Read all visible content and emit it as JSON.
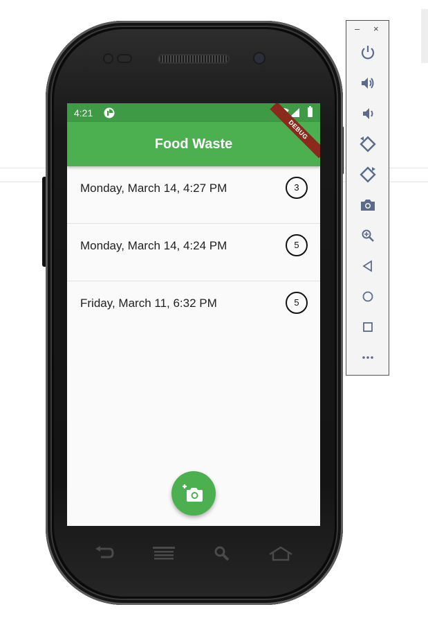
{
  "app": {
    "title": "Food Waste",
    "debug_banner": "DEBUG",
    "status_bar": {
      "time": "4:21"
    }
  },
  "entries": [
    {
      "label": "Monday, March 14, 4:27 PM",
      "count": "3"
    },
    {
      "label": "Monday, March 14, 4:24 PM",
      "count": "5"
    },
    {
      "label": "Friday, March 11, 6:32 PM",
      "count": "5"
    }
  ],
  "fab": {
    "icon": "add-a-photo-icon"
  },
  "device_nav": [
    "back-icon",
    "menu-icon",
    "search-icon",
    "home-icon"
  ],
  "emulator_toolbar": {
    "window_controls": {
      "minimize": "–",
      "close": "×"
    },
    "buttons": [
      "power-icon",
      "volume-up-icon",
      "volume-down-icon",
      "rotate-left-icon",
      "rotate-right-icon",
      "screenshot-icon",
      "zoom-icon",
      "back-icon",
      "home-icon",
      "overview-icon",
      "more-icon"
    ]
  },
  "colors": {
    "primary": "#4caf50",
    "status_bar": "#3e9a45",
    "debug_banner": "#8b2a1c"
  }
}
